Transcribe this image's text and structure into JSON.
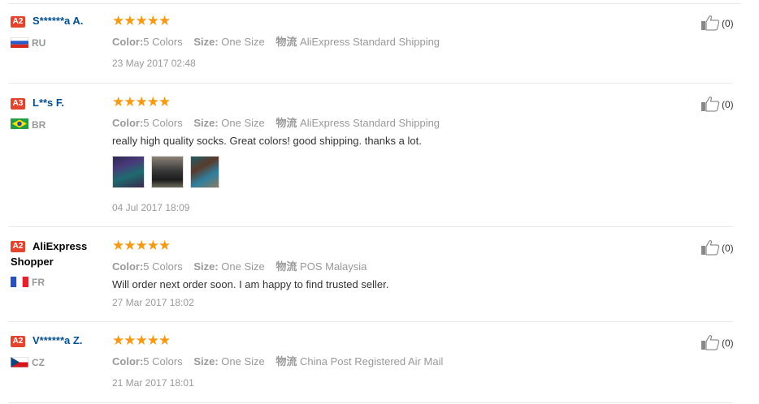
{
  "labels": {
    "color": "Color:",
    "size": "Size:",
    "logistics": "物流"
  },
  "reviews": [
    {
      "level": "A2",
      "name": "S******a A.",
      "country": "RU",
      "color": "5 Colors",
      "size": "One Size",
      "shipping": "AliExpress Standard Shipping",
      "feedback": "",
      "date": "23 May 2017 02:48",
      "helpful": "(0)",
      "rating": 5
    },
    {
      "level": "A3",
      "name": "L**s F.",
      "country": "BR",
      "color": "5 Colors",
      "size": "One Size",
      "shipping": "AliExpress Standard Shipping",
      "feedback": "really high quality socks. Great colors! good shipping. thanks a lot.",
      "date": "04 Jul 2017 18:09",
      "helpful": "(0)",
      "rating": 5,
      "photos": 3
    },
    {
      "level": "A2",
      "name_line1": "AliExpress",
      "name_line2": "Shopper",
      "country": "FR",
      "color": "5 Colors",
      "size": "One Size",
      "shipping": "POS Malaysia",
      "feedback": "Will order next order soon. I am happy to find trusted seller.",
      "date": "27 Mar 2017 18:02",
      "helpful": "(0)",
      "rating": 5
    },
    {
      "level": "A2",
      "name": "V******a Z.",
      "country": "CZ",
      "color": "5 Colors",
      "size": "One Size",
      "shipping": "China Post Registered Air Mail",
      "feedback": "",
      "date": "21 Mar 2017 18:01",
      "helpful": "(0)",
      "rating": 5
    }
  ],
  "colors": {
    "accent": "#f59a12",
    "name_link": "#05508f",
    "level_badge": "#e4442d",
    "muted": "#999999"
  },
  "icons": {
    "star": "star-icon",
    "thumb": "thumbs-up-icon"
  }
}
